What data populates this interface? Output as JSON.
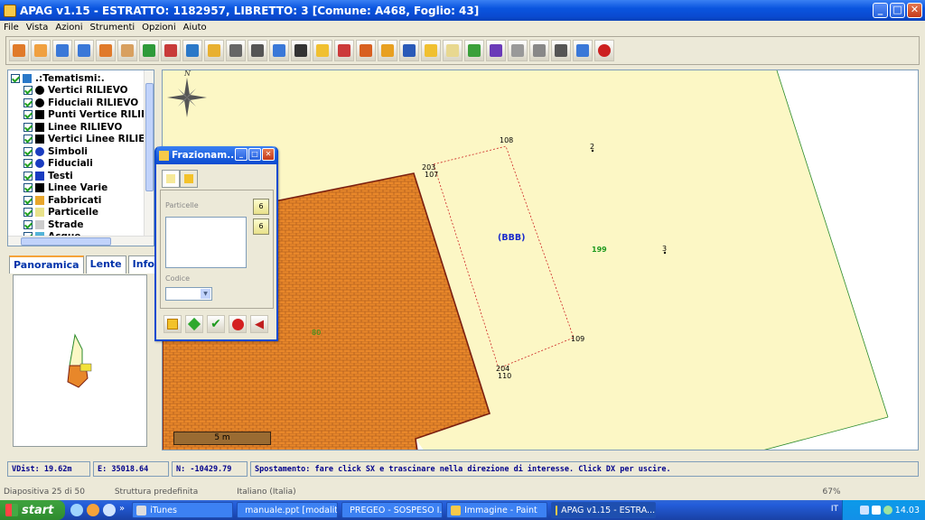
{
  "window": {
    "title": "APAG v1.15 - ESTRATTO: 1182957, LIBRETTO: 3 [Comune: A468, Foglio: 43]"
  },
  "menu": [
    "File",
    "Vista",
    "Azioni",
    "Strumenti",
    "Opzioni",
    "Aiuto"
  ],
  "toolbar_icons": [
    "undo-icon",
    "redo-icon",
    "zoom-in-icon",
    "zoom-out-icon",
    "zoom-window-icon",
    "pan-hand-icon",
    "zoom-extents-icon",
    "full-extents-icon",
    "globe-icon",
    "ruler-icon",
    "select-arrow-icon",
    "binoculars-icon",
    "search-icon",
    "table-icon",
    "layers-icon",
    "measure-icon",
    "edit-parcel-icon",
    "frazionamento-icon",
    "save-icon",
    "parcel-split-icon",
    "number-6-icon",
    "pencil-icon",
    "vertex-icon",
    "window-icon",
    "grid-icon",
    "print-icon",
    "help-icon",
    "power-icon"
  ],
  "layers": {
    "root": ".:Tematismi:.",
    "items": [
      {
        "label": "Vertici RILIEVO",
        "icon": "asterisk-icon",
        "color": "#000000"
      },
      {
        "label": "Fiduciali RILIEVO",
        "icon": "target-icon",
        "color": "#000000"
      },
      {
        "label": "Punti Vertice RILIEVO",
        "icon": "point-vertex-icon",
        "color": "#000000"
      },
      {
        "label": "Linee RILIEVO",
        "icon": "line-icon",
        "color": "#000000"
      },
      {
        "label": "Vertici Linee RILIEVO",
        "icon": "line-vertex-icon",
        "color": "#000000"
      },
      {
        "label": "Simboli",
        "icon": "anchor-icon",
        "color": "#1a3cc0"
      },
      {
        "label": "Fiduciali",
        "icon": "target-icon",
        "color": "#1a3cc0"
      },
      {
        "label": "Testi",
        "icon": "text-t-icon",
        "color": "#1a3cc0"
      },
      {
        "label": "Linee Varie",
        "icon": "line-icon",
        "color": "#000000"
      },
      {
        "label": "Fabbricati",
        "icon": "building-icon",
        "color": "#E8A62C"
      },
      {
        "label": "Particelle",
        "icon": "parcel-icon",
        "color": "#E8E28A"
      },
      {
        "label": "Strade",
        "icon": "road-icon",
        "color": "#cccccc"
      },
      {
        "label": "Acque",
        "icon": "water-icon",
        "color": "#53b4d8"
      }
    ]
  },
  "tabs": [
    "Panoramica",
    "Lente",
    "Info"
  ],
  "map": {
    "labels": {
      "p108": "108",
      "p203": "203",
      "p107": "107",
      "p2": "2",
      "bbb": "(BBB)",
      "p199": "199",
      "p3": "3",
      "p80": "80",
      "p109": "109",
      "p204": "204",
      "p110": "110"
    },
    "scale": "5 m",
    "colors": {
      "parcel": "#FCF7C5",
      "building": "#E8872A",
      "brick_line": "#A0521A",
      "boundary": "#7a1f10",
      "dashed": "#cc2222",
      "label_blue": "#1a2acc",
      "label_green": "#1f9a1f"
    }
  },
  "dialog": {
    "title": "Frazionam...",
    "particelle_label": "Particelle",
    "codice_label": "Codice",
    "side_btn_1": "6",
    "side_btn_2": "6"
  },
  "status": {
    "vdist": "VDist: 19.62m",
    "east": "E:  35018.64",
    "north": "N:  -10429.79",
    "message": "Spostamento: fare click SX e trascinare nella direzione di interesse. Click DX per uscire."
  },
  "background_strip": {
    "left": "Diapositiva 25 di 50",
    "middle": "Struttura predefinita",
    "right": "Italiano (Italia)",
    "zoom": "67%"
  },
  "taskbar": {
    "start": "start",
    "more": "»",
    "items": [
      {
        "label": "iTunes",
        "active": false
      },
      {
        "label": "manuale.ppt [modalit...",
        "active": false
      },
      {
        "label": "PREGEO - SOSPESO I...",
        "active": false
      },
      {
        "label": "Immagine - Paint",
        "active": false
      },
      {
        "label": "APAG v1.15 - ESTRA...",
        "active": true
      }
    ],
    "language": "IT",
    "clock": "14.03"
  }
}
